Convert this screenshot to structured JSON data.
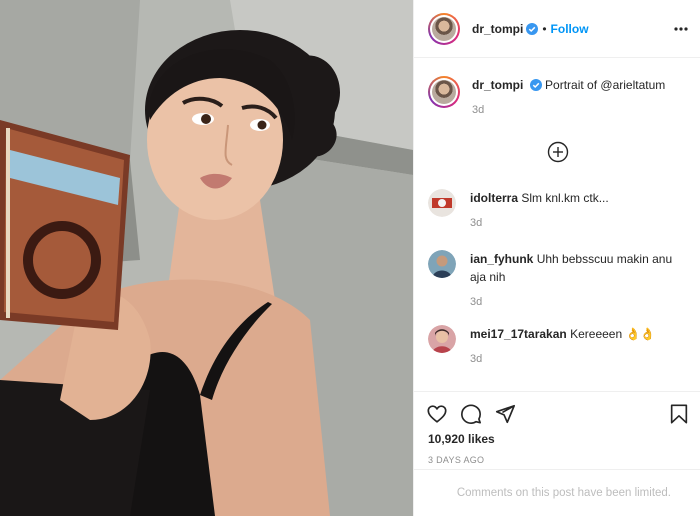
{
  "header": {
    "username": "dr_tompi",
    "separator": "•",
    "follow_label": "Follow",
    "verified_icon": "verified-badge-icon",
    "more_icon": "more-options-icon"
  },
  "caption": {
    "username": "dr_tompi",
    "text": "Portrait of @arieltatum",
    "time": "3d"
  },
  "load_more_icon": "plus-circle-icon",
  "comments": [
    {
      "username": "idolterra",
      "text": "Slm knl.km ctk...",
      "time": "3d"
    },
    {
      "username": "ian_fyhunk",
      "text": "Uhh bebsscuu makin anu aja nih",
      "time": "3d"
    },
    {
      "username": "mei17_17tarakan",
      "text": "Kereeeen 👌👌",
      "time": "3d"
    }
  ],
  "actions": {
    "like_icon": "heart-icon",
    "comment_icon": "comment-icon",
    "share_icon": "share-icon",
    "save_icon": "bookmark-icon",
    "likes": "10,920 likes",
    "date": "3 DAYS AGO"
  },
  "limited_text": "Comments on this post have been limited.",
  "colors": {
    "link_blue": "#0095f6",
    "verified_blue": "#3897f0",
    "muted": "#8e8e8e",
    "divider": "#efefef"
  }
}
